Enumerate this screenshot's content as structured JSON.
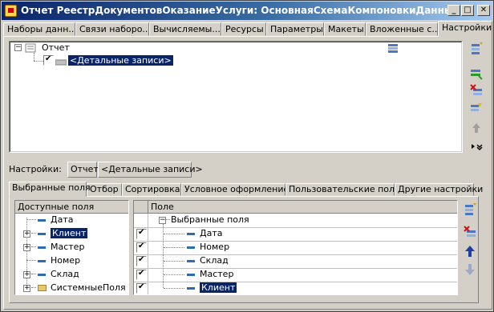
{
  "window": {
    "title": "Отчет РеестрДокументовОказаниеУслуги: ОсновнаяСхемаКомпоновкиДанных",
    "minimize": "_",
    "maximize": "□",
    "close": "✕"
  },
  "top_tabs": [
    {
      "label": "Наборы данн..."
    },
    {
      "label": "Связи наборо..."
    },
    {
      "label": "Вычисляемы..."
    },
    {
      "label": "Ресурсы"
    },
    {
      "label": "Параметры"
    },
    {
      "label": "Макеты"
    },
    {
      "label": "Вложенные с..."
    },
    {
      "label": "Настройки"
    }
  ],
  "structure_tree": {
    "root": "Отчет",
    "child": "<Детальные записи>",
    "child_checked": true
  },
  "settings_row": {
    "label": "Настройки:",
    "crumbs": [
      "Отчет",
      "<Детальные записи>"
    ]
  },
  "bottom_tabs": [
    {
      "label": "Выбранные поля"
    },
    {
      "label": "Отбор"
    },
    {
      "label": "Сортировка"
    },
    {
      "label": "Условное оформление"
    },
    {
      "label": "Пользовательские поля"
    },
    {
      "label": "Другие настройки"
    }
  ],
  "available_fields": {
    "header": "Доступные поля",
    "items": [
      {
        "label": "Дата",
        "expandable": false,
        "selected": false,
        "icon": "field-icon"
      },
      {
        "label": "Клиент",
        "expandable": true,
        "selected": true,
        "icon": "field-icon"
      },
      {
        "label": "Мастер",
        "expandable": true,
        "selected": false,
        "icon": "field-icon"
      },
      {
        "label": "Номер",
        "expandable": false,
        "selected": false,
        "icon": "field-icon"
      },
      {
        "label": "Склад",
        "expandable": true,
        "selected": false,
        "icon": "field-icon"
      },
      {
        "label": "СистемныеПоля",
        "expandable": true,
        "selected": false,
        "icon": "folder-icon"
      }
    ]
  },
  "selected_fields": {
    "header": "Поле",
    "group": "Выбранные поля",
    "items": [
      {
        "label": "Дата",
        "checked": true,
        "selected": false
      },
      {
        "label": "Номер",
        "checked": true,
        "selected": false
      },
      {
        "label": "Склад",
        "checked": true,
        "selected": false
      },
      {
        "label": "Мастер",
        "checked": true,
        "selected": false
      },
      {
        "label": "Клиент",
        "checked": true,
        "selected": true
      }
    ]
  },
  "icons": {
    "accent": "#0a246a",
    "field_color": "#2b6cb0",
    "arrow_up": "#1f3fa0"
  }
}
